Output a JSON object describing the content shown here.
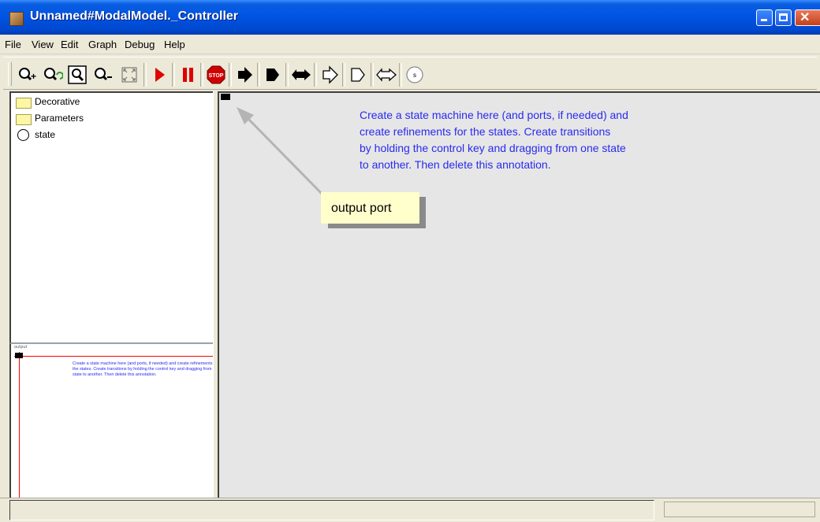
{
  "window": {
    "title": "Unnamed#ModalModel._Controller",
    "title_icon": "ptolemy-app-icon",
    "controls": [
      "minimize-icon",
      "maximize-icon",
      "close-icon"
    ]
  },
  "menu": {
    "items": [
      "File",
      "View",
      "Edit",
      "Graph",
      "Debug",
      "Help"
    ]
  },
  "toolbar": {
    "buttons": [
      {
        "name": "zoom-in-button",
        "icon": "zoom-in-icon"
      },
      {
        "name": "zoom-reset-button",
        "icon": "zoom-reset-icon"
      },
      {
        "name": "zoom-fit-button",
        "icon": "zoom-fit-icon"
      },
      {
        "name": "zoom-out-button",
        "icon": "zoom-out-icon"
      },
      {
        "name": "full-screen-button",
        "icon": "full-screen-icon"
      },
      {
        "name": "run-button",
        "icon": "play-icon"
      },
      {
        "name": "pause-button",
        "icon": "pause-icon"
      },
      {
        "name": "stop-button",
        "icon": "stop-icon"
      },
      {
        "name": "input-port-button",
        "icon": "input-port-icon"
      },
      {
        "name": "output-port-button",
        "icon": "output-port-icon"
      },
      {
        "name": "inout-port-button",
        "icon": "inout-port-icon"
      },
      {
        "name": "input-multiport-button",
        "icon": "input-multiport-icon"
      },
      {
        "name": "output-multiport-button",
        "icon": "output-multiport-icon"
      },
      {
        "name": "inout-multiport-button",
        "icon": "inout-multiport-icon"
      },
      {
        "name": "state-button",
        "icon": "state-icon",
        "label": "s"
      }
    ],
    "accent_red": "#e00000",
    "stop_label": "STOP"
  },
  "library": {
    "items": [
      {
        "label": "Decorative",
        "icon": "folder-icon"
      },
      {
        "label": "Parameters",
        "icon": "folder-icon"
      },
      {
        "label": "state",
        "icon": "state-icon"
      }
    ]
  },
  "overview": {
    "port_label": "output",
    "annotation": "Create a state machine here (and ports, if needed) and create refinements for the states.  Create transitions by holding the control key and dragging from one state to another. Then delete this annotation."
  },
  "canvas": {
    "annotation_line1": "Create a state machine here (and ports, if needed) and",
    "annotation_line2": "create refinements for the states.  Create transitions",
    "annotation_line3": "by holding the control key and dragging from one state",
    "annotation_line4": "to another. Then delete this annotation.",
    "annotation_color": "#2a2af0",
    "callout_label": "output port",
    "callout_color": "#ffffcc",
    "background": "#e6e6e6"
  },
  "status": {
    "message": ""
  }
}
